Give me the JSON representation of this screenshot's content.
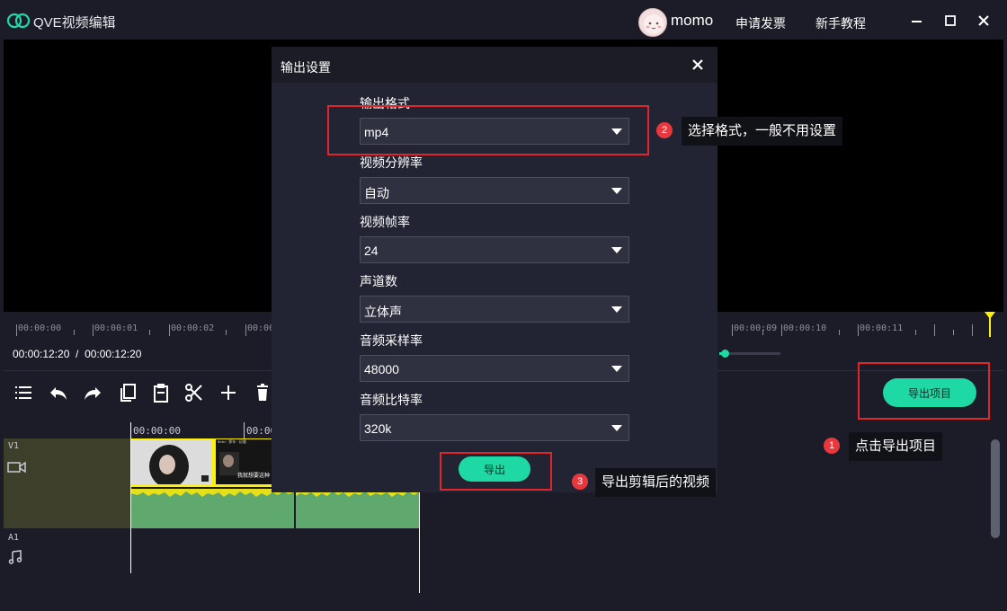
{
  "app": {
    "title": "QVE视频编辑",
    "username": "momo",
    "links": [
      "申请发票",
      "新手教程"
    ]
  },
  "ruler": {
    "labels": [
      "00:00:00",
      "00:00:01",
      "00:00:02",
      "00:00",
      "00:00:09",
      "00:00:10",
      "00:00:11"
    ],
    "timecode": "00:00:12:20  /  00:00:12:20"
  },
  "toolbar": {
    "icons": [
      "list-icon",
      "undo-icon",
      "redo-icon",
      "copy-icon",
      "paste-icon",
      "scissors-icon",
      "plus-icon",
      "trash-icon"
    ],
    "export_project_label": "导出项目"
  },
  "timeline": {
    "ruler_labels": [
      "00:00:00",
      "00:00"
    ],
    "video_track_label": "V1",
    "audio_track_label": "A1",
    "clip_overlay_text": "我就想要这种",
    "clip_tag_text": "5min · 那年 · 初遇"
  },
  "dialog": {
    "title": "输出设置",
    "fields": [
      {
        "label": "输出格式",
        "value": "mp4"
      },
      {
        "label": "视频分辨率",
        "value": "自动"
      },
      {
        "label": "视频帧率",
        "value": "24"
      },
      {
        "label": "声道数",
        "value": "立体声"
      },
      {
        "label": "音频采样率",
        "value": "48000"
      },
      {
        "label": "音频比特率",
        "value": "320k"
      }
    ],
    "export_label": "导出"
  },
  "annotations": [
    {
      "num": "1",
      "text": "点击导出项目"
    },
    {
      "num": "2",
      "text": "选择格式，一般不用设置"
    },
    {
      "num": "3",
      "text": "导出剪辑后的视频"
    }
  ],
  "colors": {
    "accent": "#1ed9a4",
    "background": "#1b1c27",
    "annotation_red": "#e0262a",
    "clip_yellow": "#fff200",
    "audio_green": "#5fa86e"
  }
}
